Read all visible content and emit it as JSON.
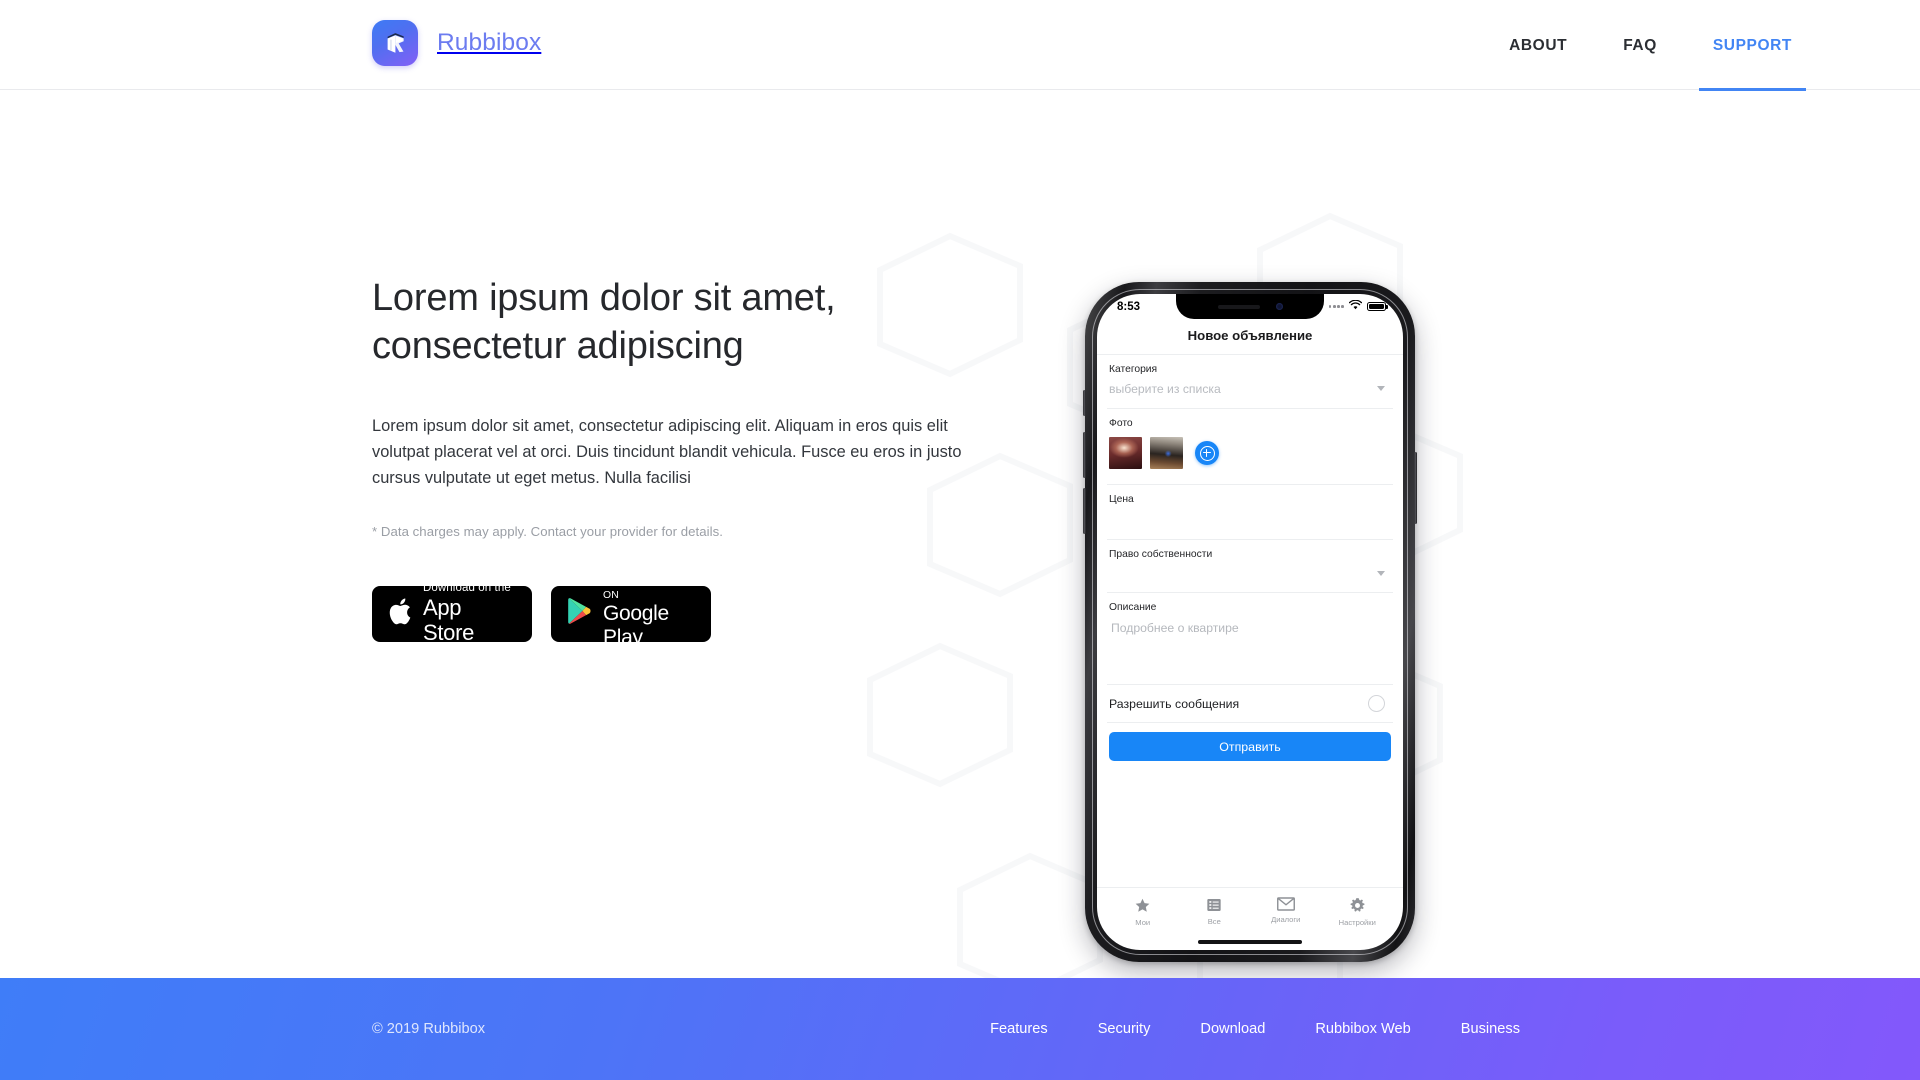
{
  "header": {
    "brand_name": "Rubbibox",
    "logo_icon": "rubbibox-box-logo",
    "nav": [
      {
        "label": "ABOUT",
        "active": false
      },
      {
        "label": "FAQ",
        "active": false
      },
      {
        "label": "SUPPORT",
        "active": true
      }
    ],
    "accent_color": "#4285f4",
    "brand_text_color": "#6c7cf0"
  },
  "hero": {
    "title": "Lorem ipsum dolor sit amet, consectetur adipiscing",
    "body": "Lorem ipsum dolor sit amet, consectetur adipiscing elit. Aliquam in eros quis elit volutpat placerat vel at orci. Duis tincidunt blandit vehicula. Fusce eu eros in justo cursus vulputate ut eget metus. Nulla facilisi",
    "note": "* Data charges may apply. Contact your provider for details.",
    "badges": {
      "apple": {
        "top": "Download on the",
        "bottom": "App Store",
        "icon": "apple-icon"
      },
      "google": {
        "top": "ANDROID APP ON",
        "bottom": "Google Play",
        "icon": "google-play-icon"
      }
    }
  },
  "phone": {
    "status_bar": {
      "time": "8:53",
      "signal_icon": "signal-dots-icon",
      "wifi_icon": "wifi-icon",
      "battery_icon": "battery-full-icon"
    },
    "app_title": "Новое объявление",
    "fields": {
      "category_label": "Категория",
      "category_value": "выберите из списка",
      "photo_label": "Фото",
      "add_photo_icon": "add-circle-icon",
      "price_label": "Цена",
      "price_value": "",
      "ownership_label": "Право собственности",
      "ownership_value": "",
      "description_label": "Описание",
      "description_placeholder": "Подробнее о квартире"
    },
    "switch_label": "Разрешить сообщения",
    "submit_label": "Отправить",
    "accent_color": "#1886f7",
    "tabs": [
      {
        "label": "Мои",
        "icon": "star-icon"
      },
      {
        "label": "Все",
        "icon": "list-icon"
      },
      {
        "label": "Диалоги",
        "icon": "envelope-icon"
      },
      {
        "label": "Настройки",
        "icon": "gear-icon"
      }
    ]
  },
  "footer": {
    "copyright": "© 2019 Rubbibox",
    "links": [
      {
        "label": "Features"
      },
      {
        "label": "Security"
      },
      {
        "label": "Download"
      },
      {
        "label": "Rubbibox Web"
      },
      {
        "label": "Business"
      }
    ],
    "gradient_from": "#3f7df8",
    "gradient_to": "#8358fb"
  }
}
